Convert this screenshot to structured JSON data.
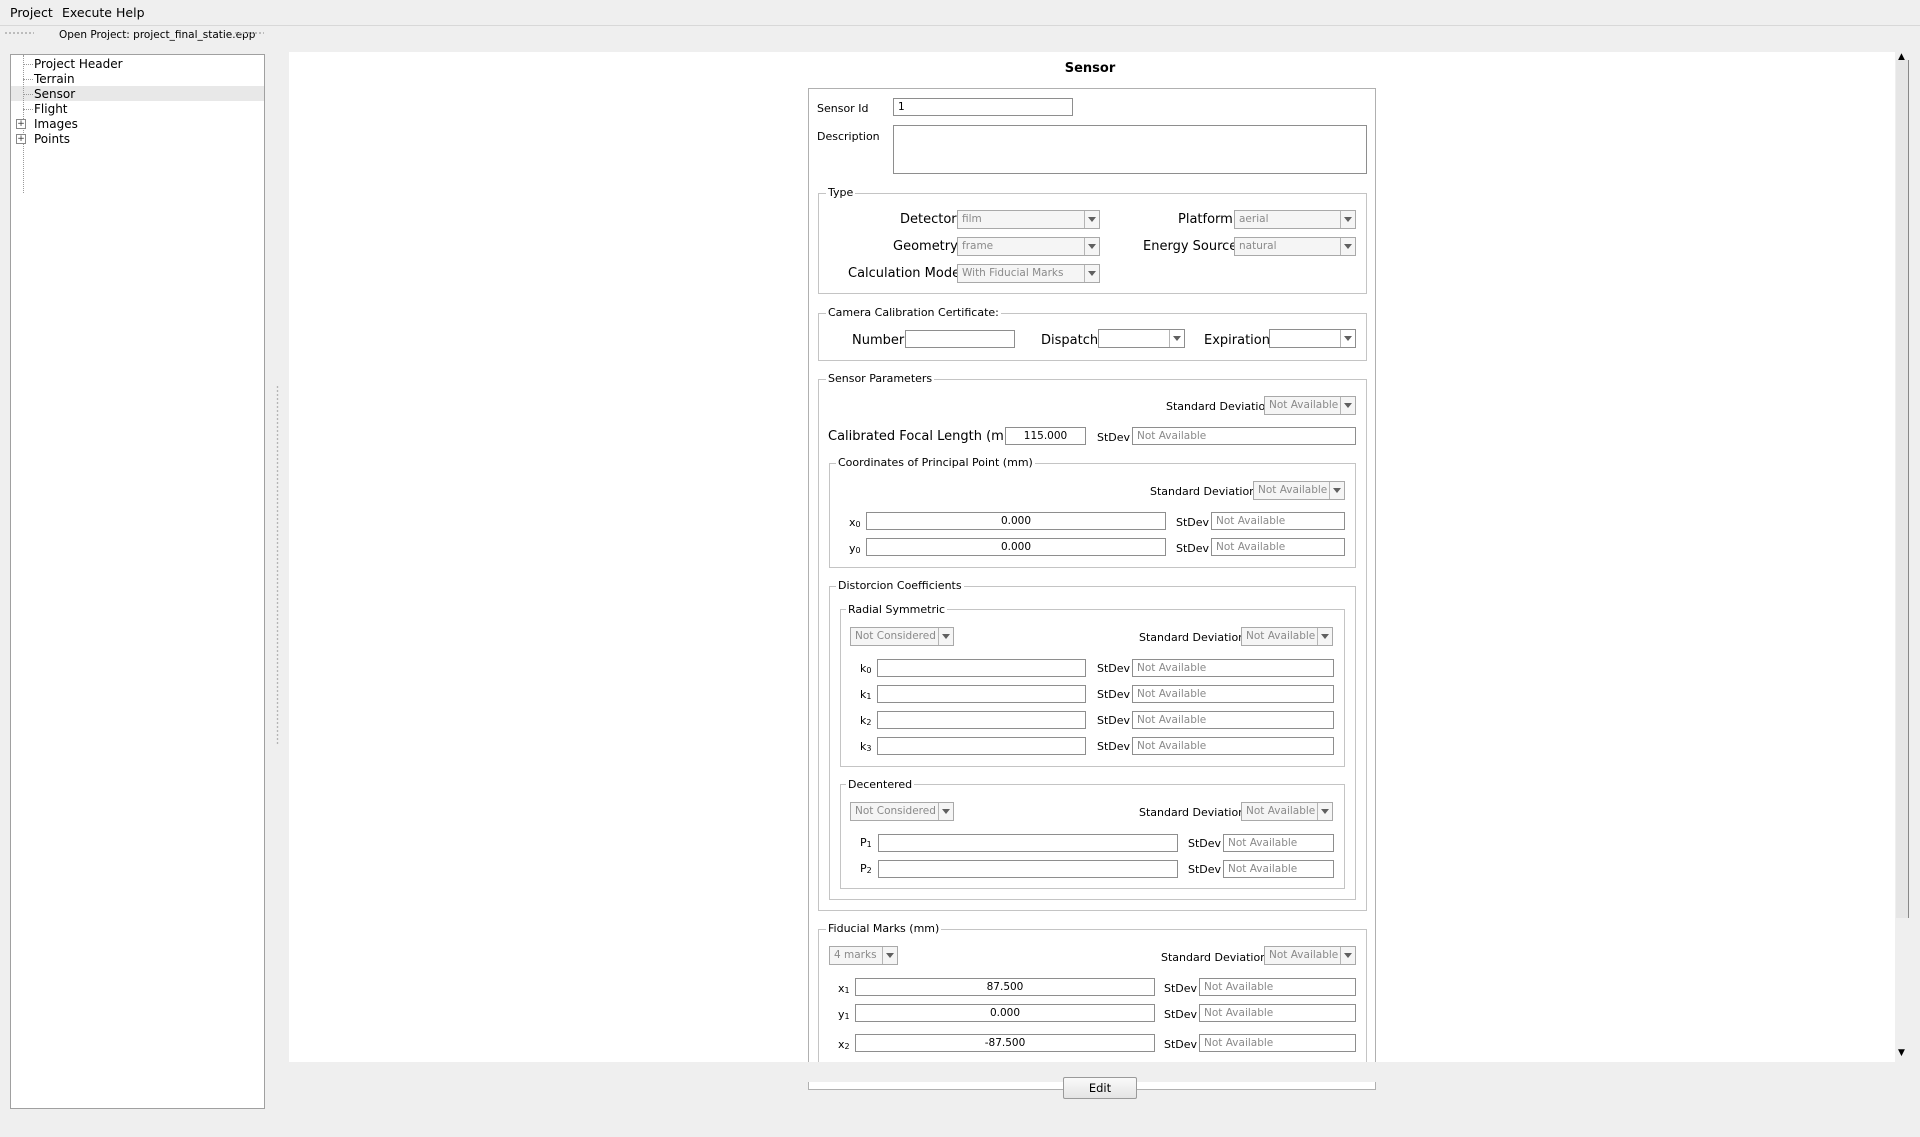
{
  "menu": {
    "project": "Project",
    "execute": "Execute",
    "help": "Help"
  },
  "toolbar": {
    "open_project": "Open Project: project_final_statie.epp"
  },
  "tree": {
    "items": [
      "Project Header",
      "Terrain",
      "Sensor",
      "Flight",
      "Images",
      "Points"
    ],
    "selected": "Sensor"
  },
  "sensor": {
    "title": "Sensor",
    "sensor_id_label": "Sensor Id",
    "sensor_id": "1",
    "description_label": "Description",
    "description": ""
  },
  "type_group": {
    "title": "Type",
    "detector_label": "Detector",
    "detector": "film",
    "geometry_label": "Geometry",
    "geometry": "frame",
    "calc_model_label": "Calculation Model",
    "calc_model": "With Fiducial Marks",
    "platform_label": "Platform",
    "platform": "aerial",
    "energy_label": "Energy Source",
    "energy": "natural"
  },
  "calibration": {
    "title": "Camera Calibration Certificate:",
    "number_label": "Number",
    "number": "",
    "dispatch_label": "Dispatch",
    "dispatch": "",
    "expiration_label": "Expiration",
    "expiration": ""
  },
  "sensor_params": {
    "title": "Sensor Parameters",
    "std_dev_label": "Standard Deviation",
    "std_dev": "Not Available",
    "focal_label": "Calibrated Focal Length (mm)",
    "focal": "115.000",
    "stdev_label": "StDev",
    "focal_stdev_ph": "Not Available",
    "pp_title": "Coordinates of Principal Point (mm)",
    "pp_std_devs_label": "Standard Deviations",
    "pp_std_devs": "Not Available",
    "x0_label": "x",
    "x0_sub": "0",
    "x0": "0.000",
    "x0_stdev_ph": "Not Available",
    "y0_label": "y",
    "y0_sub": "0",
    "y0": "0.000",
    "y0_stdev_ph": "Not Available"
  },
  "distortion": {
    "title": "Distorcion Coefficients",
    "radial_title": "Radial Symmetric",
    "radial_mode": "Not Considered",
    "radial_std_devs_label": "Standard Deviations",
    "radial_std_devs": "Not Available",
    "k": [
      {
        "label": "k",
        "sub": "0",
        "value": "",
        "stdev_ph": "Not Available"
      },
      {
        "label": "k",
        "sub": "1",
        "value": "",
        "stdev_ph": "Not Available"
      },
      {
        "label": "k",
        "sub": "2",
        "value": "",
        "stdev_ph": "Not Available"
      },
      {
        "label": "k",
        "sub": "3",
        "value": "",
        "stdev_ph": "Not Available"
      }
    ],
    "decentered_title": "Decentered",
    "decentered_mode": "Not Considered",
    "dec_std_devs_label": "Standard Deviations",
    "dec_std_devs": "Not Available",
    "p": [
      {
        "label": "P",
        "sub": "1",
        "value": "",
        "stdev_ph": "Not Available"
      },
      {
        "label": "P",
        "sub": "2",
        "value": "",
        "stdev_ph": "Not Available"
      }
    ]
  },
  "fiducial": {
    "title": "Fiducial Marks (mm)",
    "marks": "4 marks",
    "std_devs_label": "Standard Deviations",
    "std_devs": "Not Available",
    "rows": [
      {
        "label": "x",
        "sub": "1",
        "value": "87.500",
        "stdev_ph": "Not Available"
      },
      {
        "label": "y",
        "sub": "1",
        "value": "0.000",
        "stdev_ph": "Not Available"
      },
      {
        "label": "x",
        "sub": "2",
        "value": "-87.500",
        "stdev_ph": "Not Available"
      }
    ]
  },
  "edit_button": "Edit"
}
